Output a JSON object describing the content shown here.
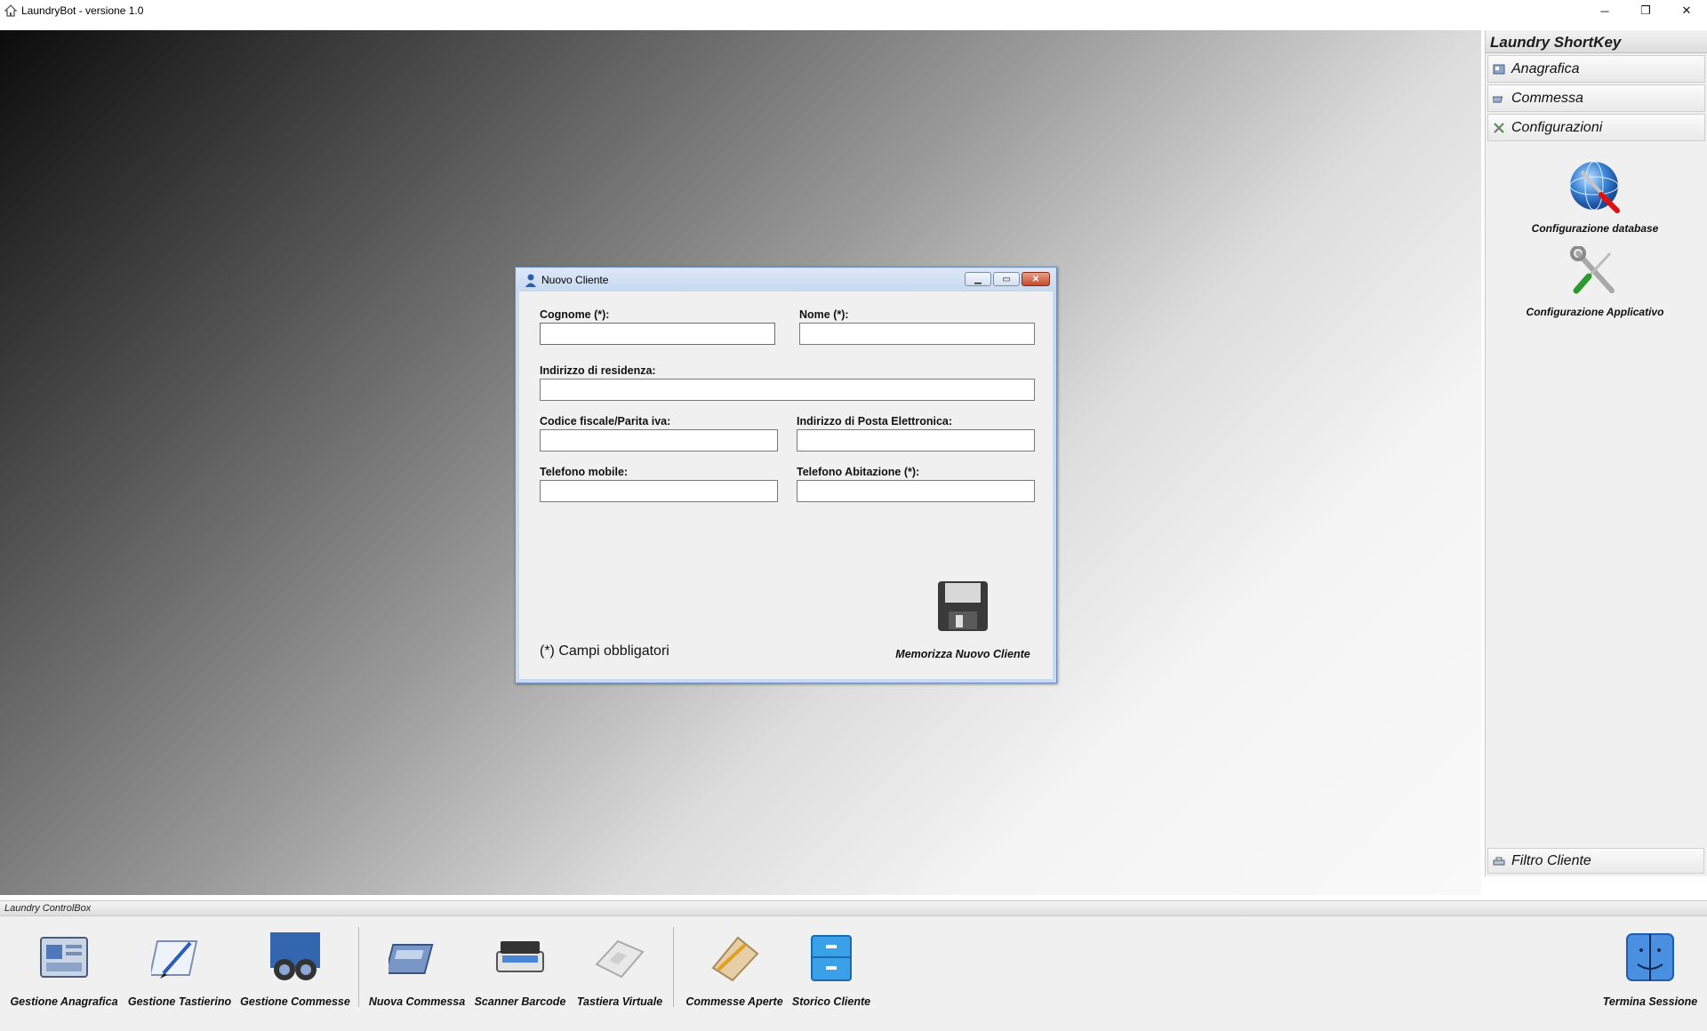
{
  "window": {
    "title": "LaundryBot - versione 1.0",
    "controls": {
      "minimize": "─",
      "maximize": "❐",
      "close": "✕"
    }
  },
  "sidebar": {
    "header": "Laundry ShortKey",
    "groups": [
      {
        "label": "Anagrafica",
        "icon": "anagrafica-icon"
      },
      {
        "label": "Commessa",
        "icon": "commessa-icon"
      },
      {
        "label": "Configurazioni",
        "icon": "tools-icon"
      }
    ],
    "tools": [
      {
        "label": "Configurazione database",
        "icon": "database-config-icon"
      },
      {
        "label": "Configurazione Applicativo",
        "icon": "app-config-icon"
      }
    ],
    "filter": {
      "label": "Filtro Cliente",
      "icon": "filter-icon"
    }
  },
  "controlbox": {
    "header": "Laundry ControlBox",
    "buttons": [
      {
        "label": "Gestione Anagrafica",
        "icon": "registry-icon"
      },
      {
        "label": "Gestione Tastierino",
        "icon": "keypad-icon"
      },
      {
        "label": "Gestione Commesse",
        "icon": "binoculars-icon"
      },
      {
        "label": "Nuova Commessa",
        "icon": "new-order-icon"
      },
      {
        "label": "Scanner Barcode",
        "icon": "scanner-icon"
      },
      {
        "label": "Tastiera Virtuale",
        "icon": "virtual-keyboard-icon"
      },
      {
        "label": "Commesse Aperte",
        "icon": "open-orders-icon"
      },
      {
        "label": "Storico Cliente",
        "icon": "archive-icon"
      },
      {
        "label": "Termina Sessione",
        "icon": "logout-finder-icon"
      }
    ]
  },
  "dialog": {
    "title": "Nuovo Cliente",
    "fields": {
      "cognome": {
        "label": "Cognome (*):",
        "value": ""
      },
      "nome": {
        "label": "Nome (*):",
        "value": ""
      },
      "indirizzo": {
        "label": "Indirizzo di residenza:",
        "value": ""
      },
      "codice_fiscale": {
        "label": "Codice fiscale/Parita iva:",
        "value": ""
      },
      "email": {
        "label": "Indirizzo di Posta Elettronica:",
        "value": ""
      },
      "telefono_mobile": {
        "label": "Telefono mobile:",
        "value": ""
      },
      "telefono_abitazione": {
        "label": "Telefono Abitazione (*):",
        "value": ""
      }
    },
    "required_note": "(*) Campi obbligatori",
    "save_button": {
      "label": "Memorizza Nuovo Cliente",
      "icon": "floppy-disk-icon"
    }
  },
  "colors": {
    "dialog_border": "#6e8dbb",
    "dialog_titlebar": "#c8d9ef",
    "close_button": "#c44a2c",
    "focus": "#3a73c7"
  }
}
